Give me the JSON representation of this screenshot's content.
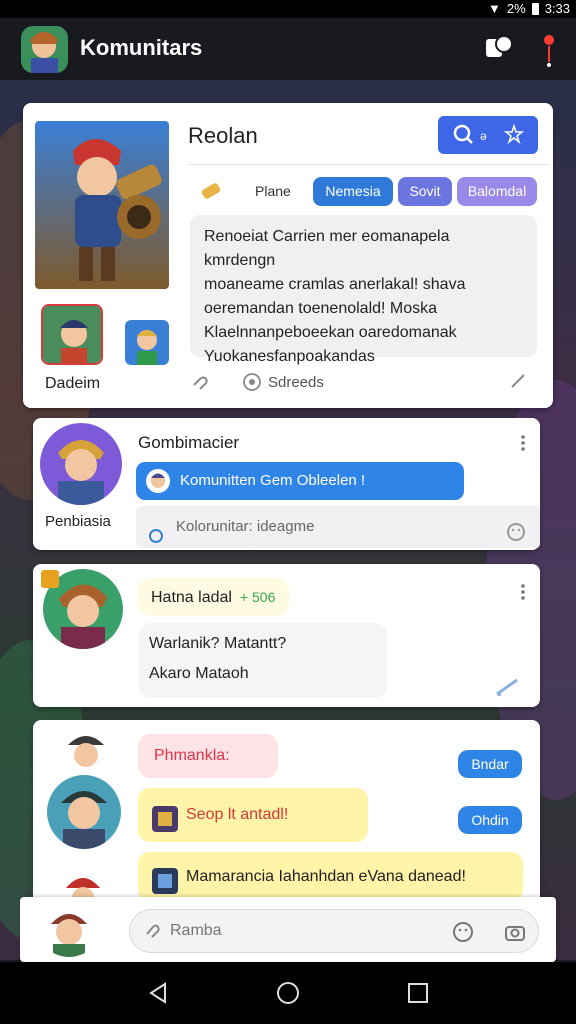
{
  "status_bar": {
    "battery": "2%",
    "time": "3:33"
  },
  "app_bar": {
    "title": "Komunitars"
  },
  "card1": {
    "title": "Reolan",
    "search_pill": "Q ə",
    "filter_label": "Plane",
    "chips": [
      "Nemesia",
      "Sovit",
      "Balomdal"
    ],
    "message_lines": [
      "Renoeiat Carrien mer eomanapela kmrdengn",
      "moaneame cramlas anerlakal!  shava",
      "oeremandan toenenolald!  Moska",
      "Klaelnnanpeboeekan oaredomanak",
      "Yuokanesfanpoakandas"
    ],
    "user_label": "Dadeim",
    "views_text": "Sdreeds"
  },
  "card2": {
    "name": "Gombimacier",
    "user_label": "Penbiasia",
    "pill_text": "Komunitten Gem Obleelen !",
    "reply_placeholder": "Kolorunitar: ideagme"
  },
  "card3": {
    "score_label": "Hatna ladal",
    "score_value": "+ 506",
    "lines": [
      "Warlanik?  Matantt?",
      "Akaro  Mataoh"
    ]
  },
  "card4": {
    "bubble1": "Phmankla:",
    "bubble2": "Seop lt antadl!",
    "bubble3": "Mamarancia Iahanhdan eVana danead!",
    "tag1": "Bndar",
    "tag2": "Ohdin"
  },
  "composer": {
    "placeholder": "Ramba"
  }
}
